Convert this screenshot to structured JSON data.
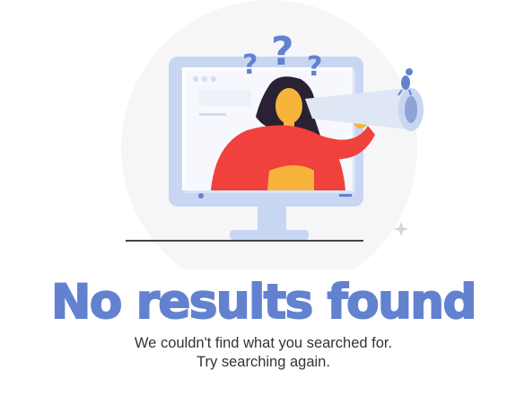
{
  "empty_state": {
    "title": "No results found",
    "message_line1": "We couldn't find what you searched for.",
    "message_line2": "Try searching again."
  },
  "colors": {
    "accent": "#6282d0",
    "shirt": "#f0413c",
    "skin": "#f6b53a",
    "monitor": "#c9d6f2"
  }
}
